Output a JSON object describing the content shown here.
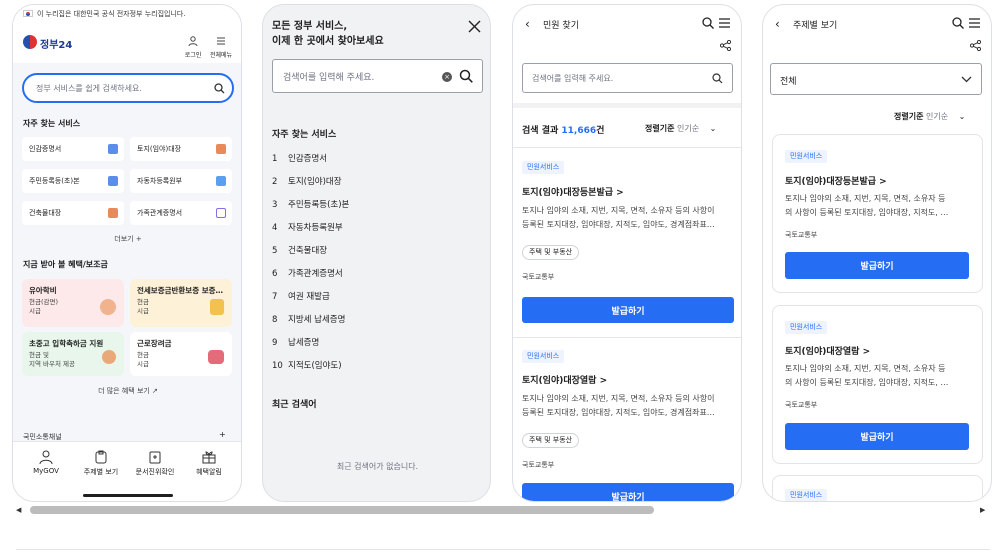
{
  "screen1": {
    "banner": "이 누리집은 대한민국 공식 전자정부 누리집입니다.",
    "logo": "정부24",
    "login": "로그인",
    "menu": "전체메뉴",
    "search_placeholder": "정부 서비스를 쉽게 검색하세요.",
    "freq_title": "자주 찾는 서비스",
    "freq_items": [
      "인감증명서",
      "토지(임야)대장",
      "주민등록등(초)본",
      "자동차등록원부",
      "건축물대장",
      "가족관계증명서"
    ],
    "more": "더보기 +",
    "benefit_title": "지금 받아 볼 혜택/보조금",
    "benefits": [
      {
        "title": "유아학비",
        "l1": "현금(감면)",
        "l2": "시급"
      },
      {
        "title": "전세보증금반환보증 보증…",
        "l1": "현금",
        "l2": "시급"
      },
      {
        "title": "초중고 입학축하금 지원",
        "l1": "현금 및",
        "l2": "지역 바우처 제공"
      },
      {
        "title": "근로장려금",
        "l1": "현금",
        "l2": "시급"
      }
    ],
    "more_benefit": "더 많은 혜택 보기",
    "partial_section": "국민소통채널",
    "nav": [
      "MyGOV",
      "주제별 보기",
      "문서진위확인",
      "혜택알림"
    ],
    "colors": {
      "accent": "#256ef4",
      "bg": "#f4f6f9"
    }
  },
  "screen2": {
    "title_l1": "모든 정부 서비스,",
    "title_l2": "이제 한 곳에서 찾아보세요",
    "search_placeholder": "검색어를 입력해 주세요.",
    "freq_title": "자주 찾는 서비스",
    "items": [
      {
        "n": "1",
        "t": "인감증명서"
      },
      {
        "n": "2",
        "t": "토지(임야)대장"
      },
      {
        "n": "3",
        "t": "주민등록등(초)본"
      },
      {
        "n": "4",
        "t": "자동차등록원부"
      },
      {
        "n": "5",
        "t": "건축물대장"
      },
      {
        "n": "6",
        "t": "가족관계증명서"
      },
      {
        "n": "7",
        "t": "여권 재발급"
      },
      {
        "n": "8",
        "t": "지방세 납세증명"
      },
      {
        "n": "9",
        "t": "납세증명"
      },
      {
        "n": "10",
        "t": "지적도(임야도)"
      }
    ],
    "recent_title": "최근 검색어",
    "recent_empty": "최근 검색어가 없습니다."
  },
  "screen3": {
    "title": "민원 찾기",
    "search_placeholder": "검색어를 입력해 주세요.",
    "result_prefix": "검색 결과 ",
    "result_count": "11,666",
    "result_suffix": "건",
    "sort_label": "정렬기준",
    "sort_value": "인기순",
    "results": [
      {
        "tag": "민원서비스",
        "title": "토지(임야)대장등본발급 >",
        "d1": "토지나 임야의 소재, 지번, 지목, 면적, 소유자 등의 사항이",
        "d2": "등록된 토지대장, 임야대장, 지적도, 임야도, 경계점좌표…",
        "chip": "주택 및 부동산",
        "org": "국토교통부",
        "btn": "발급하기"
      },
      {
        "tag": "민원서비스",
        "title": "토지(임야)대장열람 >",
        "d1": "토지나 임야의 소재, 지번, 지목, 면적, 소유자 등의 사항이",
        "d2": "등록된 토지대장, 임야대장, 지적도, 임야도, 경계점좌표…",
        "chip": "주택 및 부동산",
        "org": "국토교통부",
        "btn": "발급하기"
      }
    ]
  },
  "screen4": {
    "title": "주제별 보기",
    "select_value": "전체",
    "sort_label": "정렬기준",
    "sort_value": "인기순",
    "results": [
      {
        "tag": "민원서비스",
        "title": "토지(임야)대장등본발급 >",
        "d1": "토지나 임야의 소재, 지번, 지목, 면적, 소유자 등",
        "d2": "의 사항이 등록된 토지대장, 임야대장, 지적도, …",
        "org": "국토교통부",
        "btn": "발급하기"
      },
      {
        "tag": "민원서비스",
        "title": "토지(임야)대장열람 >",
        "d1": "토지나 임야의 소재, 지번, 지목, 면적, 소유자 등",
        "d2": "의 사항이 등록된 토지대장, 임야대장, 지적도, …",
        "org": "국토교통부",
        "btn": "발급하기"
      },
      {
        "tag": "민원서비스"
      }
    ]
  }
}
